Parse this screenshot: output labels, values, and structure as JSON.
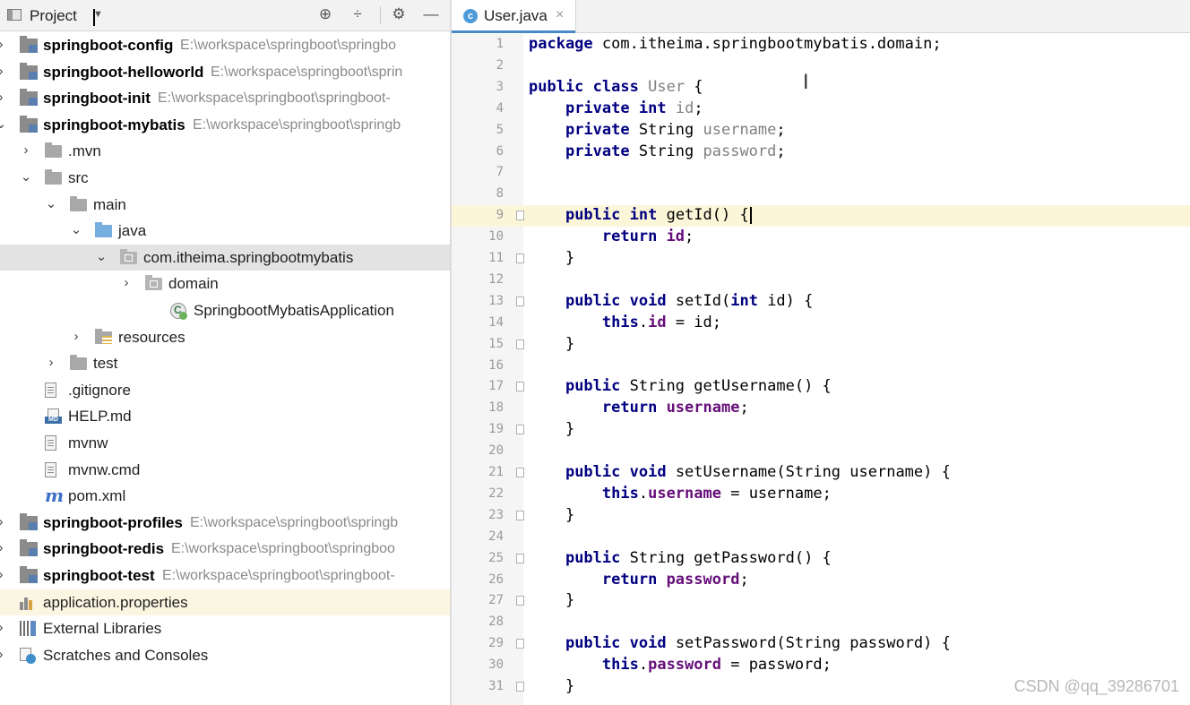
{
  "project_panel": {
    "title": "Project",
    "tree": [
      {
        "label": "springboot-config",
        "path": "E:\\workspace\\springboot\\springbo",
        "bold": true,
        "icon": "module-icon",
        "arrow": "›",
        "indent": 0
      },
      {
        "label": "springboot-helloworld",
        "path": "E:\\workspace\\springboot\\sprin",
        "bold": true,
        "icon": "module-icon",
        "arrow": "›",
        "indent": 0
      },
      {
        "label": "springboot-init",
        "path": "E:\\workspace\\springboot\\springboot-",
        "bold": true,
        "icon": "module-icon",
        "arrow": "›",
        "indent": 0
      },
      {
        "label": "springboot-mybatis",
        "path": "E:\\workspace\\springboot\\springb",
        "bold": true,
        "icon": "module-icon",
        "arrow": "⌄",
        "indent": 0
      },
      {
        "label": ".mvn",
        "path": "",
        "bold": false,
        "icon": "folder-icon",
        "arrow": "›",
        "indent": 1
      },
      {
        "label": "src",
        "path": "",
        "bold": false,
        "icon": "folder-icon",
        "arrow": "⌄",
        "indent": 1
      },
      {
        "label": "main",
        "path": "",
        "bold": false,
        "icon": "folder-icon",
        "arrow": "⌄",
        "indent": 2
      },
      {
        "label": "java",
        "path": "",
        "bold": false,
        "icon": "source-folder-icon",
        "arrow": "⌄",
        "indent": 3
      },
      {
        "label": "com.itheima.springbootmybatis",
        "path": "",
        "bold": false,
        "icon": "package-icon",
        "arrow": "⌄",
        "indent": 4,
        "selected": true
      },
      {
        "label": "domain",
        "path": "",
        "bold": false,
        "icon": "package-icon",
        "arrow": "›",
        "indent": 5
      },
      {
        "label": "SpringbootMybatisApplication",
        "path": "",
        "bold": false,
        "icon": "spring-app-icon",
        "arrow": "",
        "indent": 6
      },
      {
        "label": "resources",
        "path": "",
        "bold": false,
        "icon": "resources-folder-icon",
        "arrow": "›",
        "indent": 3
      },
      {
        "label": "test",
        "path": "",
        "bold": false,
        "icon": "folder-icon",
        "arrow": "›",
        "indent": 2
      },
      {
        "label": ".gitignore",
        "path": "",
        "bold": false,
        "icon": "text-file-icon",
        "arrow": "",
        "indent": 1
      },
      {
        "label": "HELP.md",
        "path": "",
        "bold": false,
        "icon": "markdown-file-icon",
        "arrow": "",
        "indent": 1
      },
      {
        "label": "mvnw",
        "path": "",
        "bold": false,
        "icon": "text-file-icon",
        "arrow": "",
        "indent": 1
      },
      {
        "label": "mvnw.cmd",
        "path": "",
        "bold": false,
        "icon": "text-file-icon",
        "arrow": "",
        "indent": 1
      },
      {
        "label": "pom.xml",
        "path": "",
        "bold": false,
        "icon": "maven-icon",
        "arrow": "",
        "indent": 1
      },
      {
        "label": "springboot-profiles",
        "path": "E:\\workspace\\springboot\\springb",
        "bold": true,
        "icon": "module-icon",
        "arrow": "›",
        "indent": 0
      },
      {
        "label": "springboot-redis",
        "path": "E:\\workspace\\springboot\\springboo",
        "bold": true,
        "icon": "module-icon",
        "arrow": "›",
        "indent": 0
      },
      {
        "label": "springboot-test",
        "path": "E:\\workspace\\springboot\\springboot-",
        "bold": true,
        "icon": "module-icon",
        "arrow": "›",
        "indent": 0
      },
      {
        "label": "application.properties",
        "path": "",
        "bold": false,
        "icon": "properties-file-icon",
        "arrow": "",
        "indent": 0,
        "highlight": true
      },
      {
        "label": "External Libraries",
        "path": "",
        "bold": false,
        "icon": "libraries-icon",
        "arrow": "›",
        "indent": 0
      },
      {
        "label": "Scratches and Consoles",
        "path": "",
        "bold": false,
        "icon": "scratches-icon",
        "arrow": "›",
        "indent": 0
      }
    ]
  },
  "editor": {
    "tab": {
      "label": "User.java",
      "close": "×",
      "icon_letter": "c"
    },
    "current_line": 9,
    "lines": [
      {
        "n": "1",
        "code": "package com.itheima.springbootmybatis.domain;"
      },
      {
        "n": "2",
        "code": ""
      },
      {
        "n": "3",
        "code": "public class User {"
      },
      {
        "n": "4",
        "code": "    private int id;"
      },
      {
        "n": "5",
        "code": "    private String username;"
      },
      {
        "n": "6",
        "code": "    private String password;"
      },
      {
        "n": "7",
        "code": ""
      },
      {
        "n": "8",
        "code": ""
      },
      {
        "n": "9",
        "code": "    public int getId() {"
      },
      {
        "n": "10",
        "code": "        return id;"
      },
      {
        "n": "11",
        "code": "    }"
      },
      {
        "n": "12",
        "code": ""
      },
      {
        "n": "13",
        "code": "    public void setId(int id) {"
      },
      {
        "n": "14",
        "code": "        this.id = id;"
      },
      {
        "n": "15",
        "code": "    }"
      },
      {
        "n": "16",
        "code": ""
      },
      {
        "n": "17",
        "code": "    public String getUsername() {"
      },
      {
        "n": "18",
        "code": "        return username;"
      },
      {
        "n": "19",
        "code": "    }"
      },
      {
        "n": "20",
        "code": ""
      },
      {
        "n": "21",
        "code": "    public void setUsername(String username) {"
      },
      {
        "n": "22",
        "code": "        this.username = username;"
      },
      {
        "n": "23",
        "code": "    }"
      },
      {
        "n": "24",
        "code": ""
      },
      {
        "n": "25",
        "code": "    public String getPassword() {"
      },
      {
        "n": "26",
        "code": "        return password;"
      },
      {
        "n": "27",
        "code": "    }"
      },
      {
        "n": "28",
        "code": ""
      },
      {
        "n": "29",
        "code": "    public void setPassword(String password) {"
      },
      {
        "n": "30",
        "code": "        this.password = password;"
      },
      {
        "n": "31",
        "code": "    }"
      }
    ]
  },
  "watermark": "CSDN @qq_39286701",
  "colors": {
    "keyword": "#000080",
    "field": "#660e7a",
    "current_line": "#fcf6d8",
    "selection": "#e3e3e3",
    "tab_accent": "#4a88c7"
  }
}
